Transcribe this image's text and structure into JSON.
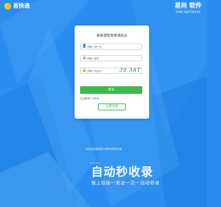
{
  "brand": {
    "left_name": "易快通",
    "left_sub": "",
    "right_title": "易尚 软件",
    "right_sub": "YIMA SOFTWARE"
  },
  "login": {
    "title": "易尚通软商商城后台",
    "username_placeholder": "请输入用户名",
    "password_placeholder": "请输入密码",
    "captcha_placeholder": "请输入验证码",
    "captcha_text": "38 3AT",
    "remember_label": "自动登录",
    "login_button": "登录",
    "forgot_text": "忘记账号?",
    "forgot_link": "去修改",
    "register_button": "立即注册"
  },
  "footer": {
    "line1": "注重业务高科技以商研与提供全面",
    "line2": "Copyright"
  },
  "watermark": {
    "title": "自动秒收录",
    "subtitle": "做上链接一来访一次一自动收录"
  },
  "colors": {
    "background": "#2b8df0",
    "primary_green": "#3cb94b",
    "card": "#ffffff"
  }
}
